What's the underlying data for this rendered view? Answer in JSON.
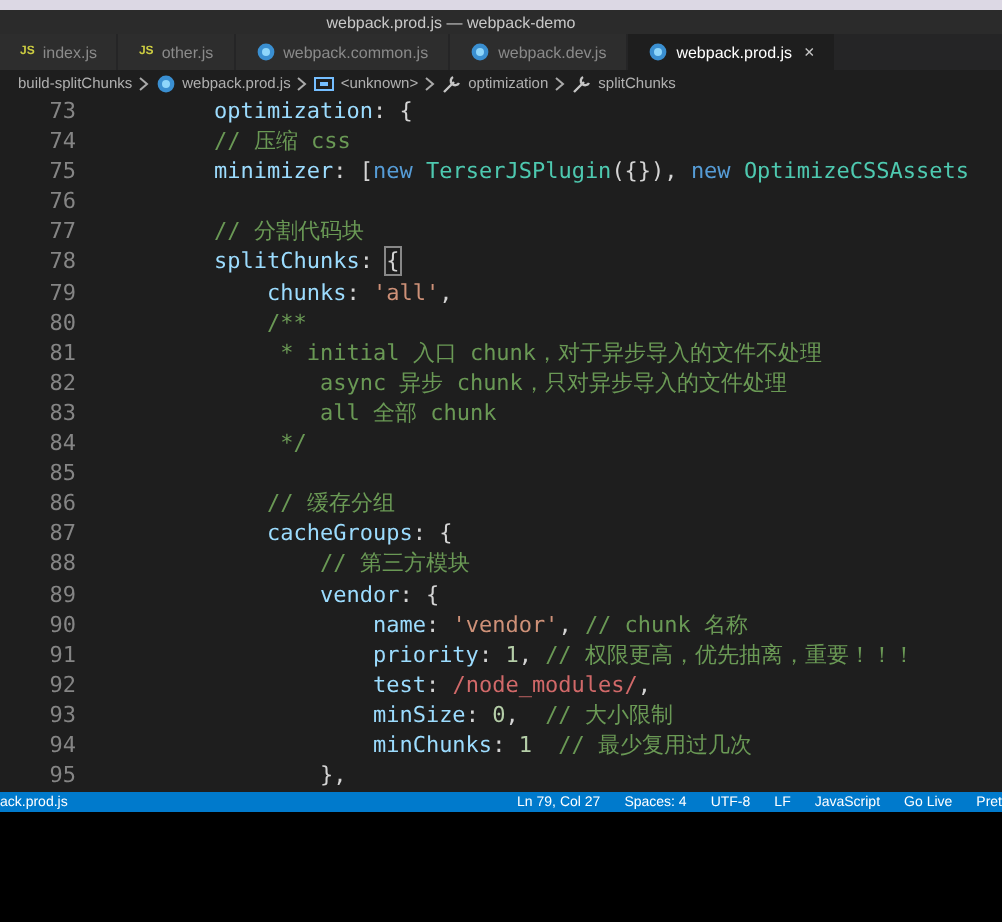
{
  "window": {
    "title": "webpack.prod.js — webpack-demo"
  },
  "tabs": [
    {
      "label": "index.js",
      "kind": "js",
      "icon_text": "JS",
      "selected": false
    },
    {
      "label": "other.js",
      "kind": "js",
      "icon_text": "JS",
      "selected": false
    },
    {
      "label": "webpack.common.js",
      "kind": "webpack",
      "selected": false
    },
    {
      "label": "webpack.dev.js",
      "kind": "webpack",
      "selected": false
    },
    {
      "label": "webpack.prod.js",
      "kind": "webpack",
      "selected": true,
      "close": "×"
    }
  ],
  "breadcrumb": [
    {
      "label": "build-splitChunks",
      "kind": "folder"
    },
    {
      "label": "webpack.prod.js",
      "kind": "webpack"
    },
    {
      "label": "<unknown>",
      "kind": "variable"
    },
    {
      "label": "optimization",
      "kind": "wrench"
    },
    {
      "label": "splitChunks",
      "kind": "wrench"
    }
  ],
  "lines": [
    {
      "number": "73",
      "tokens": [
        {
          "kind": "prop",
          "text": "        optimization"
        },
        {
          "kind": "punct",
          "text": ": {"
        }
      ]
    },
    {
      "number": "74",
      "tokens": [
        {
          "kind": "comment",
          "text": "        // 压缩 css"
        }
      ]
    },
    {
      "number": "75",
      "tokens": [
        {
          "kind": "prop",
          "text": "        minimizer"
        },
        {
          "kind": "punct",
          "text": ": ["
        },
        {
          "kind": "keyword",
          "text": "new "
        },
        {
          "kind": "class",
          "text": "TerserJSPlugin"
        },
        {
          "kind": "punct",
          "text": "({}), "
        },
        {
          "kind": "keyword",
          "text": "new "
        },
        {
          "kind": "class",
          "text": "OptimizeCSSAssets"
        }
      ]
    },
    {
      "number": "76"
    },
    {
      "number": "77",
      "tokens": [
        {
          "kind": "comment",
          "text": "        // 分割代码块"
        }
      ]
    },
    {
      "number": "78",
      "tokens": [
        {
          "kind": "prop",
          "text": "        splitChunks"
        },
        {
          "kind": "punct",
          "text": ": "
        },
        {
          "kind": "bracket",
          "text": "{"
        }
      ]
    },
    {
      "number": "79",
      "tokens": [
        {
          "kind": "prop",
          "text": "            chunks"
        },
        {
          "kind": "punct",
          "text": ": "
        },
        {
          "kind": "string",
          "text": "'all'"
        },
        {
          "kind": "punct",
          "text": ","
        }
      ]
    },
    {
      "number": "80",
      "tokens": [
        {
          "kind": "comment",
          "text": "            /**"
        }
      ]
    },
    {
      "number": "81",
      "tokens": [
        {
          "kind": "comment",
          "text": "             * initial 入口 chunk，对于异步导入的文件不处理"
        }
      ]
    },
    {
      "number": "82",
      "tokens": [
        {
          "kind": "comment",
          "text": "                async 异步 chunk，只对异步导入的文件处理"
        }
      ]
    },
    {
      "number": "83",
      "tokens": [
        {
          "kind": "comment",
          "text": "                all 全部 chunk"
        }
      ]
    },
    {
      "number": "84",
      "tokens": [
        {
          "kind": "comment",
          "text": "             */"
        }
      ]
    },
    {
      "number": "85"
    },
    {
      "number": "86",
      "tokens": [
        {
          "kind": "comment",
          "text": "            // 缓存分组"
        }
      ]
    },
    {
      "number": "87",
      "tokens": [
        {
          "kind": "prop",
          "text": "            cacheGroups"
        },
        {
          "kind": "punct",
          "text": ": {"
        }
      ]
    },
    {
      "number": "88",
      "tokens": [
        {
          "kind": "comment",
          "text": "                // 第三方模块"
        }
      ]
    },
    {
      "number": "89",
      "tokens": [
        {
          "kind": "prop",
          "text": "                vendor"
        },
        {
          "kind": "punct",
          "text": ": {"
        }
      ]
    },
    {
      "number": "90",
      "tokens": [
        {
          "kind": "prop",
          "text": "                    name"
        },
        {
          "kind": "punct",
          "text": ": "
        },
        {
          "kind": "string",
          "text": "'vendor'"
        },
        {
          "kind": "punct",
          "text": ", "
        },
        {
          "kind": "comment",
          "text": "// chunk 名称"
        }
      ]
    },
    {
      "number": "91",
      "tokens": [
        {
          "kind": "prop",
          "text": "                    priority"
        },
        {
          "kind": "punct",
          "text": ": "
        },
        {
          "kind": "number",
          "text": "1"
        },
        {
          "kind": "punct",
          "text": ", "
        },
        {
          "kind": "comment",
          "text": "// 权限更高，优先抽离，重要！！！"
        }
      ]
    },
    {
      "number": "92",
      "tokens": [
        {
          "kind": "prop",
          "text": "                    test"
        },
        {
          "kind": "punct",
          "text": ": "
        },
        {
          "kind": "regex",
          "text": "/node_modules/"
        },
        {
          "kind": "punct",
          "text": ","
        }
      ]
    },
    {
      "number": "93",
      "tokens": [
        {
          "kind": "prop",
          "text": "                    minSize"
        },
        {
          "kind": "punct",
          "text": ": "
        },
        {
          "kind": "number",
          "text": "0"
        },
        {
          "kind": "punct",
          "text": ",  "
        },
        {
          "kind": "comment",
          "text": "// 大小限制"
        }
      ]
    },
    {
      "number": "94",
      "tokens": [
        {
          "kind": "prop",
          "text": "                    minChunks"
        },
        {
          "kind": "punct",
          "text": ": "
        },
        {
          "kind": "number",
          "text": "1"
        },
        {
          "kind": "comment",
          "text": "  // 最少复用过几次"
        }
      ]
    },
    {
      "number": "95",
      "tokens": [
        {
          "kind": "punct",
          "text": "                },"
        }
      ]
    }
  ],
  "status_bar": {
    "left": "ack.prod.js",
    "right": [
      "Ln 79, Col 27",
      "Spaces: 4",
      "UTF-8",
      "LF",
      "JavaScript",
      "Go Live",
      "Pret"
    ]
  }
}
